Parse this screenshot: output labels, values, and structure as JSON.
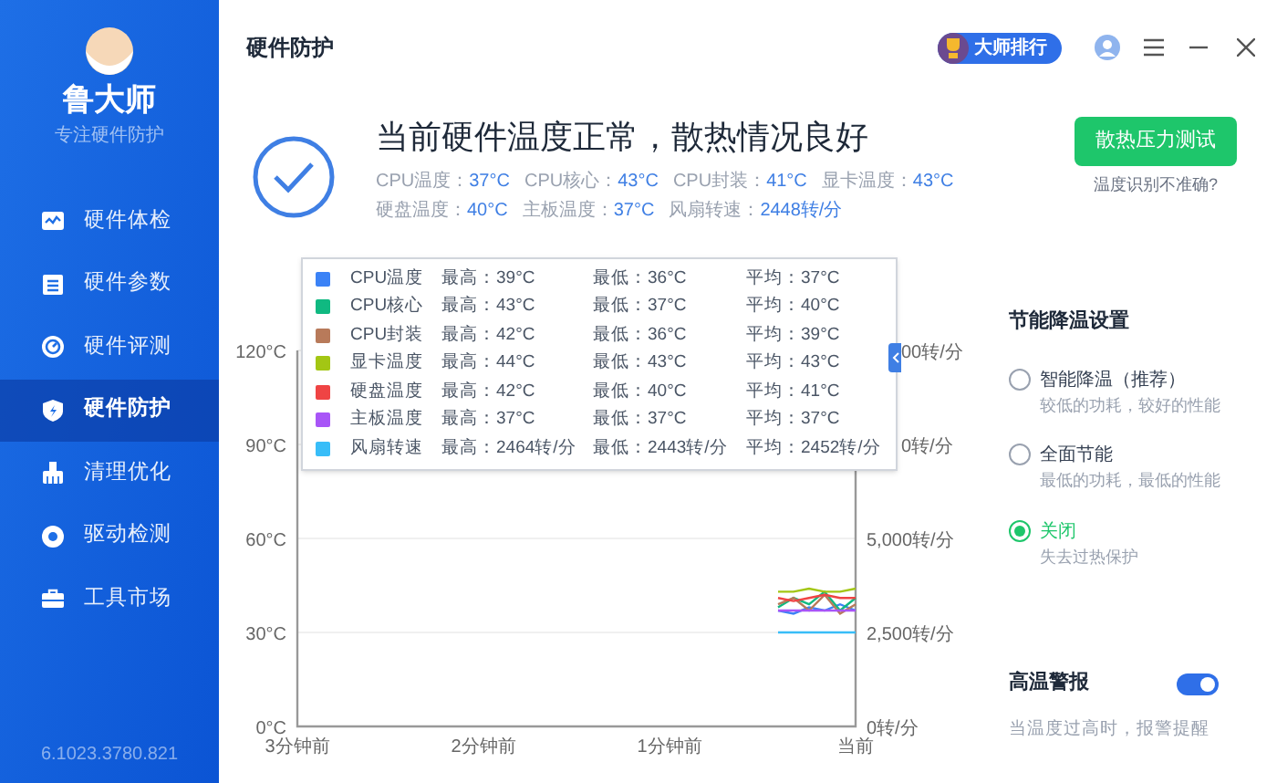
{
  "sidebar": {
    "brand": "鲁大师",
    "tagline": "专注硬件防护",
    "items": [
      {
        "label": "硬件体检",
        "selected": false
      },
      {
        "label": "硬件参数",
        "selected": false
      },
      {
        "label": "硬件评测",
        "selected": false
      },
      {
        "label": "硬件防护",
        "selected": true
      },
      {
        "label": "清理优化",
        "selected": false
      },
      {
        "label": "驱动检测",
        "selected": false
      },
      {
        "label": "工具市场",
        "selected": false
      }
    ],
    "version": "6.1023.3780.821"
  },
  "header": {
    "title": "硬件防护",
    "rank_badge": "大师排行"
  },
  "status": {
    "headline": "当前硬件温度正常，散热情况良好",
    "readings": [
      {
        "label": "CPU温度：",
        "value": "37°C"
      },
      {
        "label": "CPU核心：",
        "value": "43°C"
      },
      {
        "label": "CPU封装：",
        "value": "41°C"
      },
      {
        "label": "显卡温度：",
        "value": "43°C"
      },
      {
        "label": "硬盘温度：",
        "value": "40°C"
      },
      {
        "label": "主板温度：",
        "value": "37°C"
      },
      {
        "label": "风扇转速：",
        "value": "2448转/分"
      }
    ],
    "button": "散热压力测试",
    "link": "温度识别不准确?"
  },
  "chart": {
    "legend": [
      {
        "max": "最高：39°C",
        "min": "最低：36°C",
        "avg": "平均：37°C"
      },
      {
        "max": "最高：43°C",
        "min": "最低：37°C",
        "avg": "平均：40°C"
      },
      {
        "max": "最高：42°C",
        "min": "最低：36°C",
        "avg": "平均：39°C"
      },
      {
        "max": "最高：44°C",
        "min": "最低：43°C",
        "avg": "平均：43°C"
      },
      {
        "max": "最高：42°C",
        "min": "最低：40°C",
        "avg": "平均：41°C"
      },
      {
        "max": "最高：37°C",
        "min": "最低：37°C",
        "avg": "平均：37°C"
      },
      {
        "max": "最高：2464转/分",
        "min": "最低：2443转/分",
        "avg": "平均：2452转/分"
      }
    ],
    "chart_data": {
      "type": "line",
      "categories": [
        "3分钟前",
        null,
        null,
        null,
        null,
        null,
        null,
        null,
        null,
        null,
        null,
        null,
        "2分钟前",
        null,
        null,
        null,
        null,
        null,
        null,
        null,
        null,
        null,
        null,
        null,
        "1分钟前",
        null,
        null,
        null,
        null,
        null,
        null,
        null,
        null,
        null,
        null,
        null,
        "当前"
      ],
      "ylim": [
        0,
        120
      ],
      "yticks": [
        {
          "value": 0,
          "label": "0°C"
        },
        {
          "value": 30,
          "label": "30°C"
        },
        {
          "value": 60,
          "label": "60°C"
        },
        {
          "value": 90,
          "label": "90°C"
        },
        {
          "value": 120,
          "label": "120°C"
        }
      ],
      "y2lim": [
        0,
        10000
      ],
      "y2ticks": [
        {
          "value": 0,
          "label": "0转/分"
        },
        {
          "value": 2500,
          "label": "2,500转/分"
        },
        {
          "value": 5000,
          "label": "5,000转/分"
        }
      ],
      "grid": true,
      "legend": "top-left",
      "series": [
        {
          "name": "CPU温度",
          "color": "#3b82f6",
          "values": [
            null,
            null,
            null,
            null,
            null,
            null,
            null,
            null,
            null,
            null,
            null,
            null,
            null,
            null,
            null,
            null,
            null,
            null,
            null,
            null,
            null,
            null,
            null,
            null,
            null,
            null,
            null,
            null,
            null,
            null,
            null,
            37,
            36,
            38,
            37,
            39,
            37
          ]
        },
        {
          "name": "CPU核心",
          "color": "#10b981",
          "values": [
            null,
            null,
            null,
            null,
            null,
            null,
            null,
            null,
            null,
            null,
            null,
            null,
            null,
            null,
            null,
            null,
            null,
            null,
            null,
            null,
            null,
            null,
            null,
            null,
            null,
            null,
            null,
            null,
            null,
            null,
            null,
            38,
            41,
            39,
            43,
            37,
            41
          ]
        },
        {
          "name": "CPU封装",
          "color": "#b87a5a",
          "values": [
            null,
            null,
            null,
            null,
            null,
            null,
            null,
            null,
            null,
            null,
            null,
            null,
            null,
            null,
            null,
            null,
            null,
            null,
            null,
            null,
            null,
            null,
            null,
            null,
            null,
            null,
            null,
            null,
            null,
            null,
            null,
            39,
            41,
            37,
            42,
            36,
            39
          ]
        },
        {
          "name": "显卡温度",
          "color": "#a3c614",
          "values": [
            null,
            null,
            null,
            null,
            null,
            null,
            null,
            null,
            null,
            null,
            null,
            null,
            null,
            null,
            null,
            null,
            null,
            null,
            null,
            null,
            null,
            null,
            null,
            null,
            null,
            null,
            null,
            null,
            null,
            null,
            null,
            43,
            43,
            44,
            43,
            43,
            44
          ]
        },
        {
          "name": "硬盘温度",
          "color": "#ef4444",
          "values": [
            null,
            null,
            null,
            null,
            null,
            null,
            null,
            null,
            null,
            null,
            null,
            null,
            null,
            null,
            null,
            null,
            null,
            null,
            null,
            null,
            null,
            null,
            null,
            null,
            null,
            null,
            null,
            null,
            null,
            null,
            null,
            41,
            40,
            41,
            42,
            41,
            41
          ]
        },
        {
          "name": "主板温度",
          "color": "#a855f7",
          "values": [
            null,
            null,
            null,
            null,
            null,
            null,
            null,
            null,
            null,
            null,
            null,
            null,
            null,
            null,
            null,
            null,
            null,
            null,
            null,
            null,
            null,
            null,
            null,
            null,
            null,
            null,
            null,
            null,
            null,
            null,
            null,
            37,
            37,
            37,
            37,
            37,
            37
          ]
        },
        {
          "name": "风扇转速",
          "color": "#38bdf8",
          "axis": "y2",
          "values": [
            null,
            null,
            null,
            null,
            null,
            null,
            null,
            null,
            null,
            null,
            null,
            null,
            null,
            null,
            null,
            null,
            null,
            null,
            null,
            null,
            null,
            null,
            null,
            null,
            null,
            null,
            null,
            null,
            null,
            null,
            null,
            2500,
            2500,
            2500,
            2500,
            2500,
            2500
          ]
        }
      ]
    },
    "covered_tick_labels": [
      "00转/分",
      "0转/分"
    ]
  },
  "settings": {
    "title": "节能降温设置",
    "options": [
      {
        "label": "智能降温（推荐）",
        "description": "较低的功耗，较好的性能",
        "selected": false
      },
      {
        "label": "全面节能",
        "description": "最低的功耗，最低的性能",
        "selected": false
      },
      {
        "label": "关闭",
        "description": "失去过热保护",
        "selected": true
      }
    ],
    "alert": {
      "label": "高温警报",
      "on": true,
      "description": "当温度过高时，报警提醒"
    }
  }
}
